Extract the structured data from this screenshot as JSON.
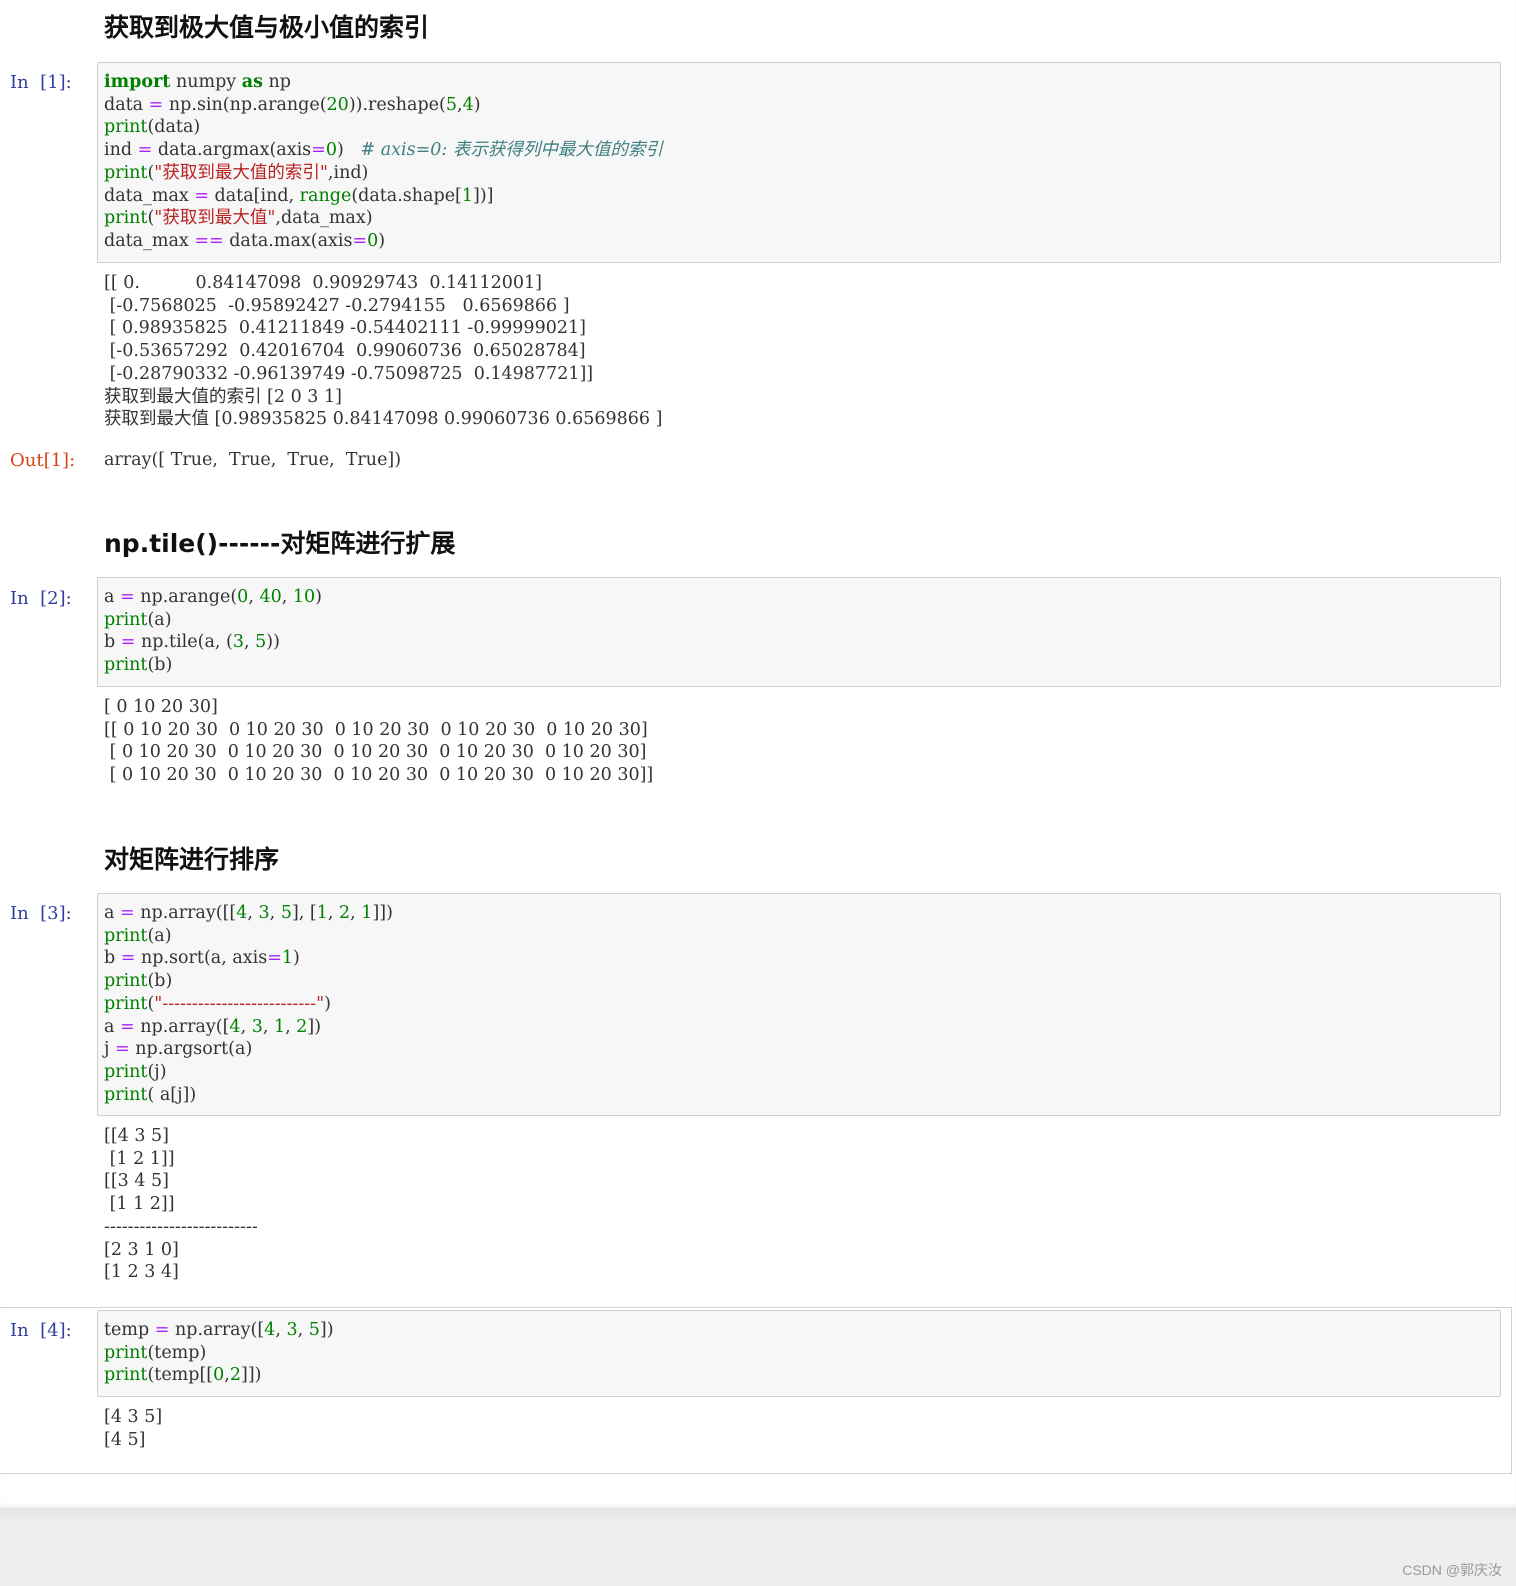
{
  "headings": {
    "h1": "获取到极大值与极小值的索引",
    "h2": "np.tile()------对矩阵进行扩展",
    "h3": "对矩阵进行排序"
  },
  "cells": [
    {
      "prompt": "In  [1]:",
      "code_lines": [
        "import numpy as np",
        "data = np.sin(np.arange(20)).reshape(5,4)",
        "print(data)",
        "ind = data.argmax(axis=0)   # axis=0: 表示获得列中最大值的索引",
        "print(\"获取到最大值的索引\",ind)",
        "data_max = data[ind, range(data.shape[1])]",
        "print(\"获取到最大值\",data_max)",
        "data_max == data.max(axis=0)"
      ],
      "stdout": "[[ 0.          0.84147098  0.90929743  0.14112001]\n [-0.7568025  -0.95892427 -0.2794155   0.6569866 ]\n [ 0.98935825  0.41211849 -0.54402111 -0.99999021]\n [-0.53657292  0.42016704  0.99060736  0.65028784]\n [-0.28790332 -0.96139749 -0.75098725  0.14987721]]\n获取到最大值的索引 [2 0 3 1]\n获取到最大值 [0.98935825 0.84147098 0.99060736 0.6569866 ]",
      "out_prompt": "Out[1]:",
      "out_value": "array([ True,  True,  True,  True])"
    },
    {
      "prompt": "In  [2]:",
      "code_lines": [
        "a = np.arange(0, 40, 10)",
        "print(a)",
        "b = np.tile(a, (3, 5))",
        "print(b)"
      ],
      "stdout": "[ 0 10 20 30]\n[[ 0 10 20 30  0 10 20 30  0 10 20 30  0 10 20 30  0 10 20 30]\n [ 0 10 20 30  0 10 20 30  0 10 20 30  0 10 20 30  0 10 20 30]\n [ 0 10 20 30  0 10 20 30  0 10 20 30  0 10 20 30  0 10 20 30]]"
    },
    {
      "prompt": "In  [3]:",
      "code_lines": [
        "a = np.array([[4, 3, 5], [1, 2, 1]])",
        "print(a)",
        "b = np.sort(a, axis=1)",
        "print(b)",
        "print(\"--------------------------\")",
        "a = np.array([4, 3, 1, 2])",
        "j = np.argsort(a)",
        "print(j)",
        "print( a[j])"
      ],
      "stdout": "[[4 3 5]\n [1 2 1]]\n[[3 4 5]\n [1 1 2]]\n--------------------------\n[2 3 1 0]\n[1 2 3 4]"
    },
    {
      "prompt": "In  [4]:",
      "code_lines": [
        "temp = np.array([4, 3, 5])",
        "print(temp)",
        "print(temp[[0,2]])"
      ],
      "stdout": "[4 3 5]\n[4 5]"
    }
  ],
  "watermark": "CSDN @郭庆汝"
}
